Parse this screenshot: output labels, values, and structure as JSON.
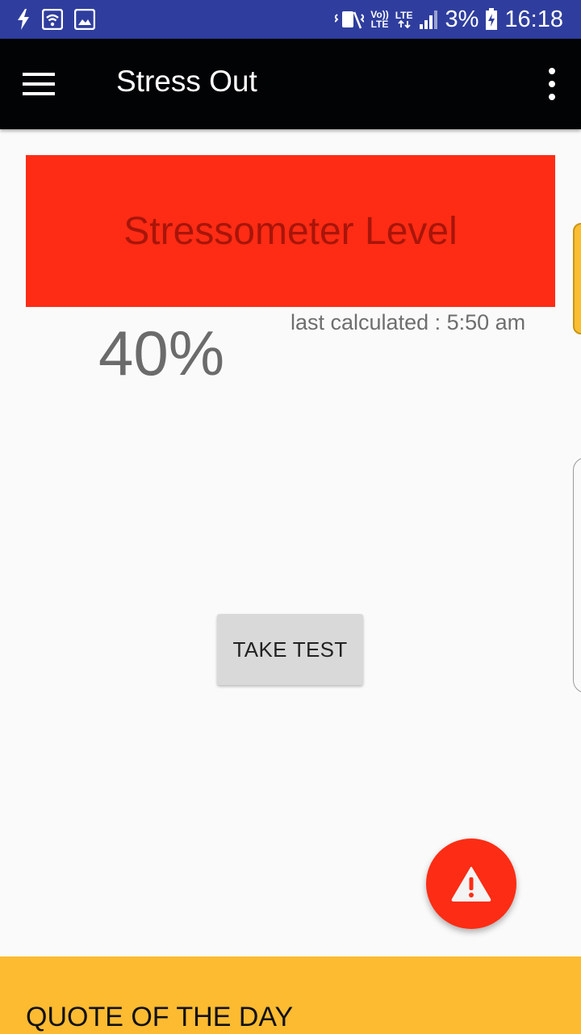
{
  "status_bar": {
    "battery_percent": "3%",
    "time": "16:18",
    "volte_label_top": "Vo))",
    "volte_label_bottom": "LTE",
    "lte_label": "LTE",
    "icons": [
      "flash-icon",
      "wifi-calling-icon",
      "gallery-icon",
      "vibrate-icon",
      "volte-icon",
      "lte-data-icon",
      "signal-icon",
      "battery-charging-icon"
    ]
  },
  "app_bar": {
    "title": "Stress Out",
    "menu_icon": "hamburger-menu-icon",
    "overflow_icon": "more-vert-icon"
  },
  "stress": {
    "banner_title": "Stressometer Level",
    "banner_color": "#fe2c14",
    "value": "40%",
    "last_calculated": "last calculated : 5:50 am"
  },
  "actions": {
    "take_test_label": "TAKE TEST",
    "fab_icon": "warning-icon",
    "fab_color": "#fd2c14"
  },
  "quote": {
    "title": "QUOTE OF THE DAY",
    "panel_color": "#fcbb31"
  }
}
